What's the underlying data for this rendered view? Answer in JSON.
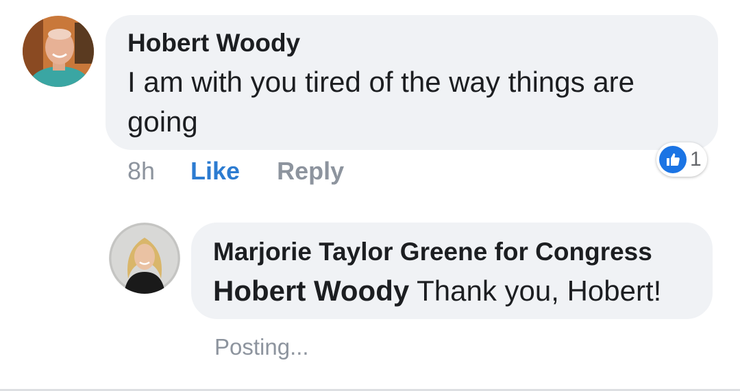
{
  "comment": {
    "author": "Hobert Woody",
    "text": "I am with you tired of the way things are going",
    "time": "8h",
    "like_label": "Like",
    "reply_label": "Reply",
    "reaction": {
      "icon": "like-icon",
      "count": "1",
      "color": "#1b74e4"
    }
  },
  "reply": {
    "author": "Marjorie Taylor Greene for Congress",
    "mention": "Hobert Woody",
    "text": "Thank you, Hobert!",
    "status": "Posting..."
  },
  "colors": {
    "bubble": "#f0f2f5",
    "like_action": "#2d7cd1",
    "muted": "#8d949e",
    "text": "#1c1e21"
  }
}
